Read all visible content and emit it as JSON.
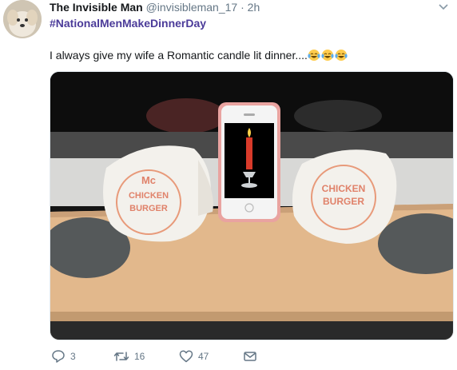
{
  "tweet": {
    "display_name": "The Invisible Man",
    "handle": "@invisibleman_17",
    "separator": "·",
    "time": "2h",
    "hashtag": "#NationalMenMakeDinnerDay",
    "text": "I always give my wife a Romantic candle lit dinner....",
    "emojis": [
      "face-with-tears-of-joy-icon",
      "face-with-tears-of-joy-icon",
      "face-with-tears-of-joy-icon"
    ],
    "icons": {
      "menu": "chevron-down-icon"
    },
    "colors": {
      "hashtag": "#4b3b99",
      "muted": "#657786"
    }
  },
  "media": {
    "wrapper_text_left": [
      "Mc",
      "CHICKEN",
      "BURGER"
    ],
    "wrapper_text_right": [
      "CHICKEN",
      "BURGER"
    ]
  },
  "actions": {
    "reply_count": "3",
    "retweet_count": "16",
    "like_count": "47",
    "icons": [
      "reply-icon",
      "retweet-icon",
      "like-icon",
      "message-icon"
    ]
  }
}
